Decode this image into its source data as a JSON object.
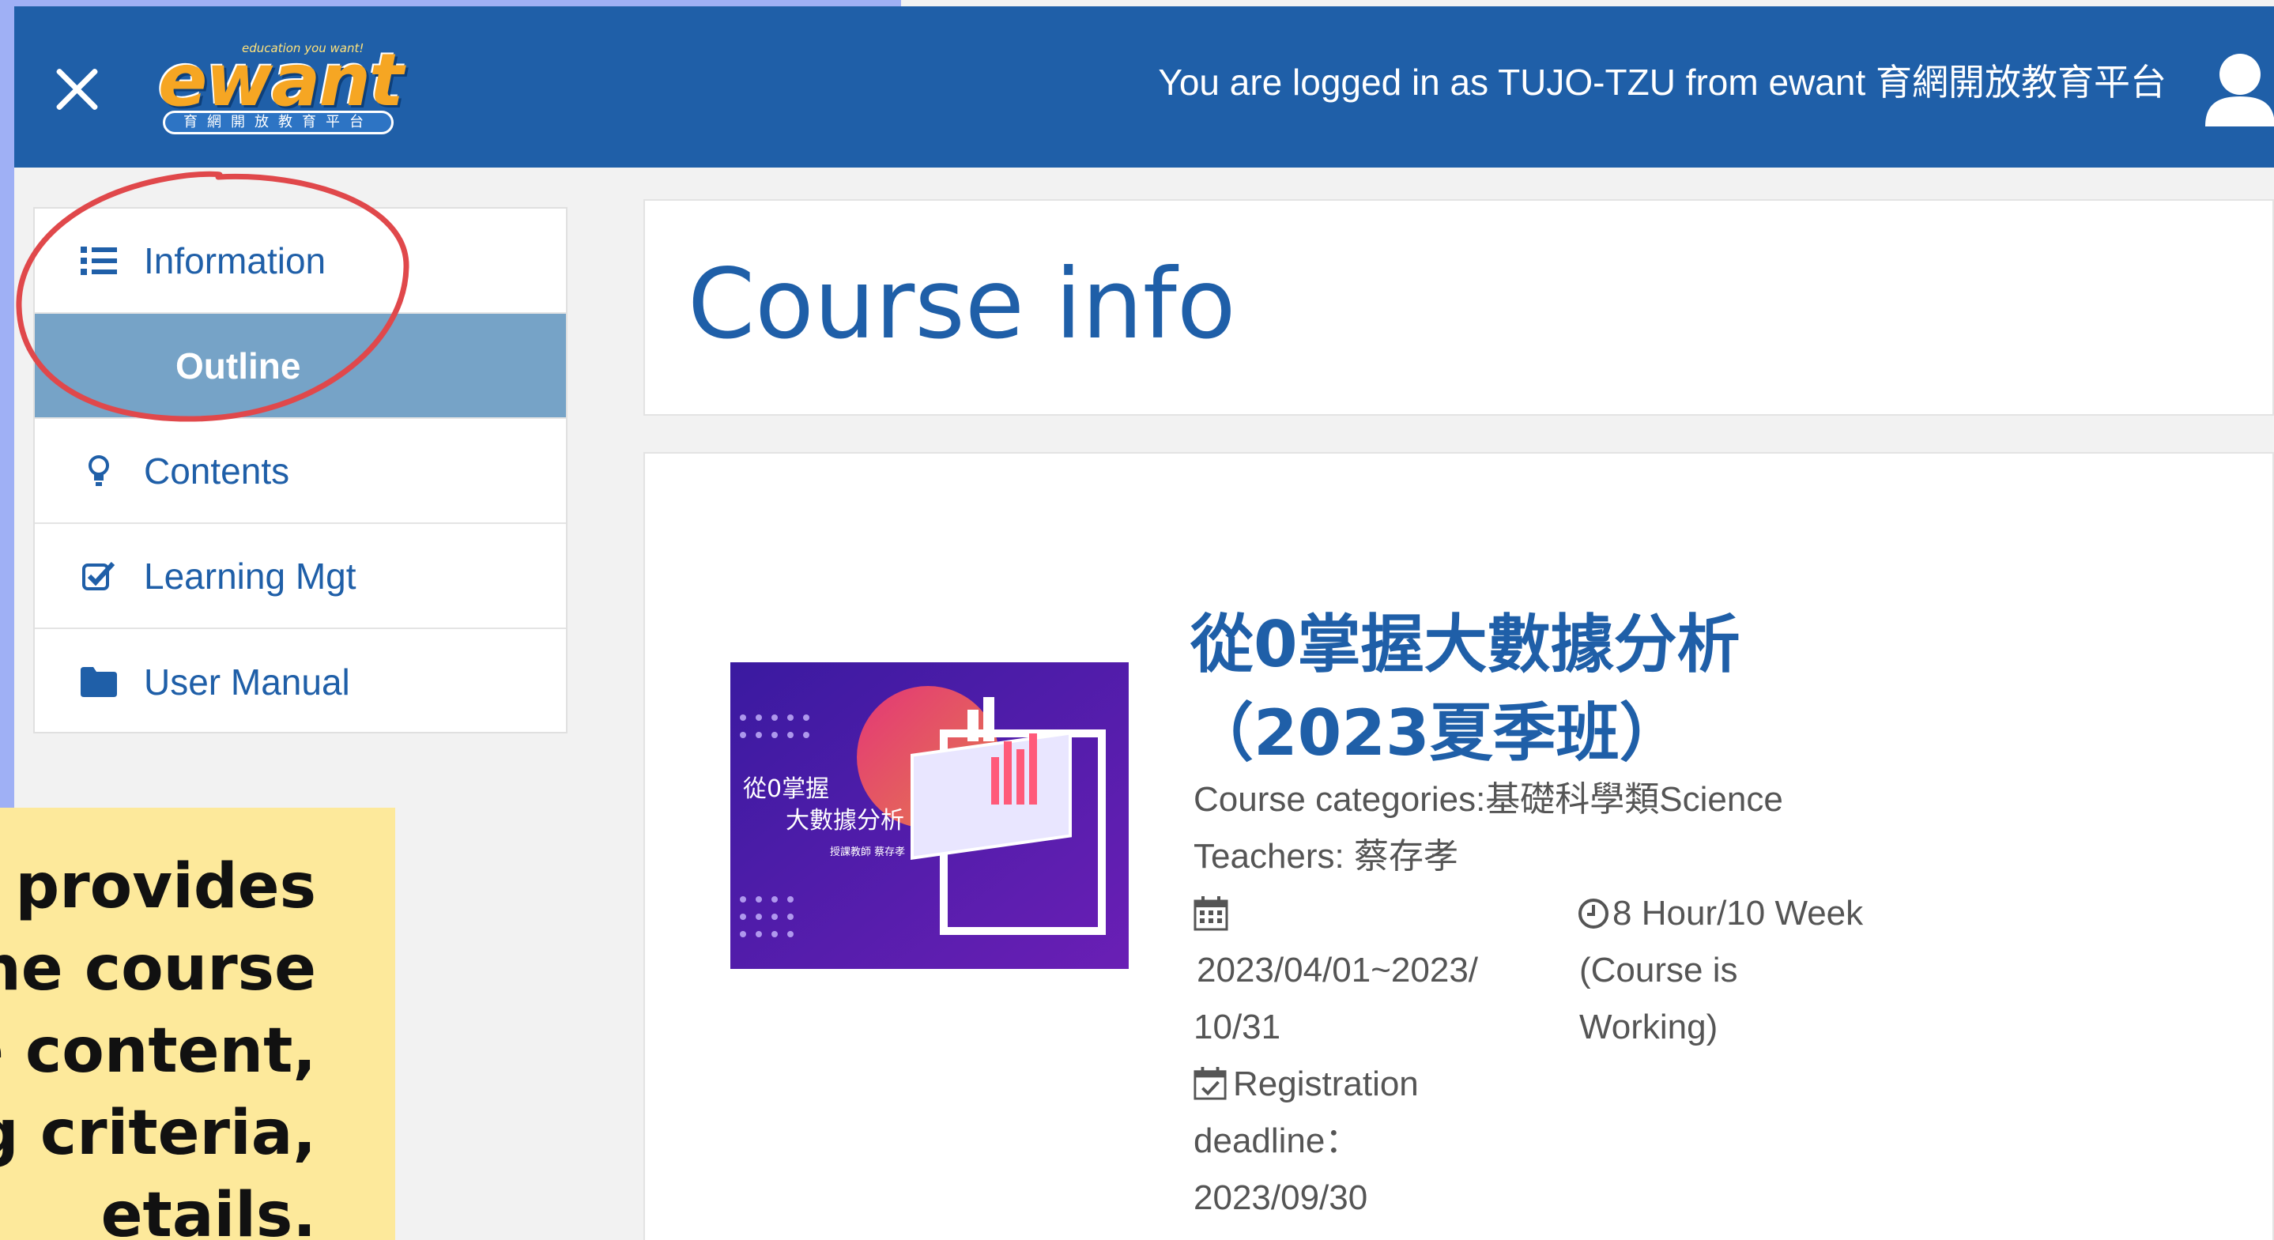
{
  "header": {
    "logo_text": "ewant",
    "logo_tagline": "education you want!",
    "logo_subtitle": "育網開放教育平台",
    "login_text": "You are logged in as TUJO-TZU from ewant 育網開放教育平台"
  },
  "sidebar": {
    "items": [
      {
        "label": "Information",
        "icon": "list-icon"
      },
      {
        "label": "Outline",
        "icon": ""
      },
      {
        "label": "Contents",
        "icon": "lightbulb-icon"
      },
      {
        "label": "Learning Mgt",
        "icon": "check-square-icon"
      },
      {
        "label": "User Manual",
        "icon": "folder-icon"
      }
    ],
    "active": "Outline"
  },
  "main": {
    "page_title": "Course info",
    "course": {
      "thumbnail_title_line1": "從0掌握",
      "thumbnail_title_line2": "大數據分析",
      "thumbnail_caption": "授課教師 蔡存孝",
      "title_line1": "從0掌握大數據分析",
      "title_line2": "（2023夏季班）",
      "categories": "Course categories:基礎科學類Science",
      "teachers": "Teachers: 蔡存孝",
      "date_line1": "2023/04/01~2023/",
      "date_line2": "10/31",
      "duration_line1": "8 Hour/10 Week",
      "duration_line2": "(Course is",
      "duration_line3": "Working)",
      "registration_label_line1": "Registration",
      "registration_label_line2": "deadline：",
      "registration_date": "2023/09/30"
    }
  },
  "caption": {
    "line1": "us provides",
    "line2": "he course",
    "line3": "e content,",
    "line4": "ing criteria,",
    "line5": "etails."
  },
  "colors": {
    "header_bg": "#1f5fa8",
    "accent_blue": "#1f5fa8",
    "active_item_bg": "#76a3c7",
    "caption_bg": "#fde99b",
    "annotation_red": "#e0484b"
  }
}
